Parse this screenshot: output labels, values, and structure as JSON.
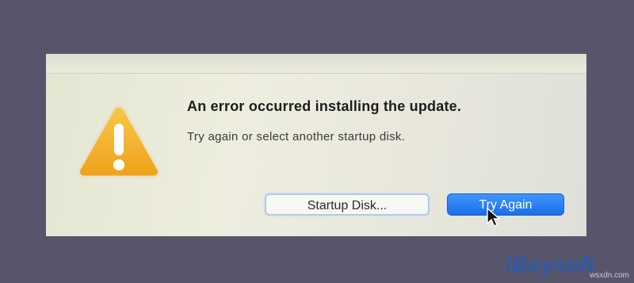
{
  "dialog": {
    "title": "An error occurred installing the update.",
    "message": "Try again or select another startup disk.",
    "icon": "warning-triangle-icon",
    "buttons": {
      "startup_disk": "Startup Disk...",
      "try_again": "Try Again"
    }
  },
  "branding": {
    "logo_text": "iBoysoft",
    "watermark": "wsxdn.com"
  },
  "colors": {
    "background": "#57556a",
    "accent_button": "#1a6fe8",
    "warning": "#f5b323"
  }
}
